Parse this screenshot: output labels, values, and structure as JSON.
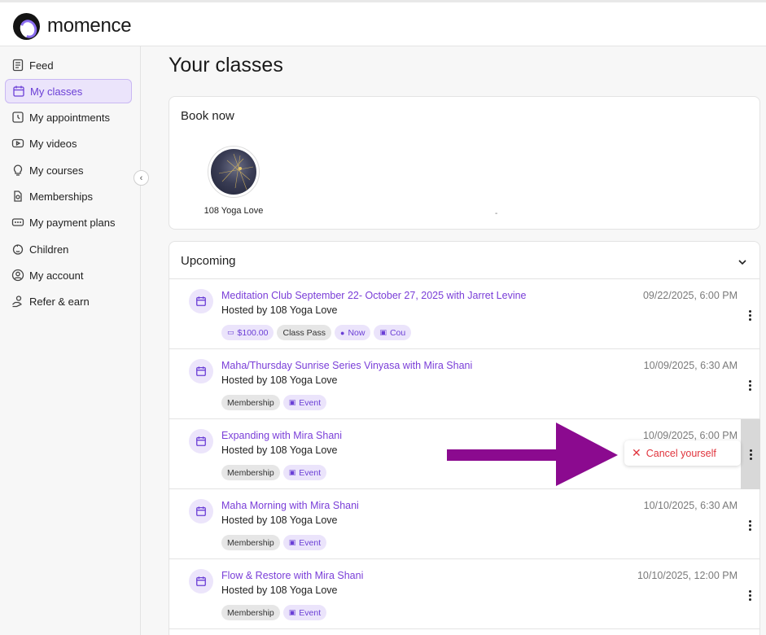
{
  "app": {
    "brand": "momence",
    "accent": "#7a3ed8"
  },
  "sidebar": {
    "items": [
      {
        "label": "Feed",
        "icon": "feed-icon"
      },
      {
        "label": "My classes",
        "icon": "calendar-icon",
        "active": true
      },
      {
        "label": "My appointments",
        "icon": "clock-icon"
      },
      {
        "label": "My videos",
        "icon": "video-icon"
      },
      {
        "label": "My courses",
        "icon": "bulb-icon"
      },
      {
        "label": "Memberships",
        "icon": "membership-icon"
      },
      {
        "label": "My payment plans",
        "icon": "payment-icon"
      },
      {
        "label": "Children",
        "icon": "child-icon"
      },
      {
        "label": "My account",
        "icon": "account-icon"
      },
      {
        "label": "Refer & earn",
        "icon": "refer-icon"
      }
    ]
  },
  "main": {
    "title": "Your classes",
    "book_now": {
      "title": "Book now",
      "studio_name": "108 Yoga Love",
      "dash": "-"
    },
    "upcoming": {
      "title": "Upcoming",
      "rows": [
        {
          "title": "Meditation Club September 22- October 27, 2025 with Jarret Levine",
          "host": "Hosted by 108 Yoga Love",
          "date": "09/22/2025, 6:00 PM",
          "tags": [
            "$100.00",
            "Class Pass",
            "Now",
            "Cou"
          ]
        },
        {
          "title": "Maha/Thursday Sunrise Series Vinyasa with Mira Shani",
          "host": "Hosted by 108 Yoga Love",
          "date": "10/09/2025, 6:30 AM",
          "tags": [
            "Membership",
            "Event"
          ]
        },
        {
          "title": "Expanding with Mira Shani",
          "host": "Hosted by 108 Yoga Love",
          "date": "10/09/2025, 6:00 PM",
          "tags": [
            "Membership",
            "Event"
          ]
        },
        {
          "title": "Maha Morning with Mira Shani",
          "host": "Hosted by 108 Yoga Love",
          "date": "10/10/2025, 6:30 AM",
          "tags": [
            "Membership",
            "Event"
          ]
        },
        {
          "title": "Flow & Restore with Mira Shani",
          "host": "Hosted by 108 Yoga Love",
          "date": "10/10/2025, 12:00 PM",
          "tags": [
            "Membership",
            "Event"
          ]
        }
      ]
    },
    "popup": {
      "label": "Cancel yourself",
      "color": "#e0343d"
    },
    "annotation": {
      "color": "#8b0a8f"
    }
  }
}
